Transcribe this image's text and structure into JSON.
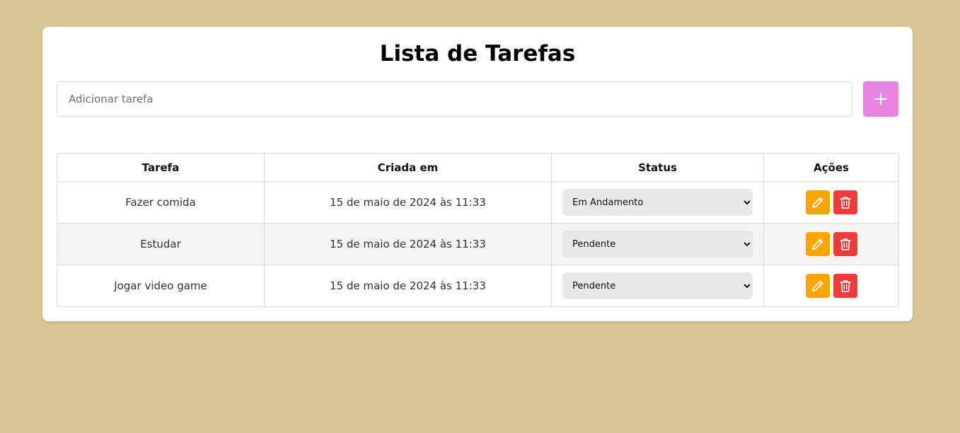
{
  "page": {
    "title": "Lista de Tarefas"
  },
  "add_task": {
    "placeholder": "Adicionar tarefa",
    "value": "",
    "button_label": "+"
  },
  "table": {
    "headers": {
      "task": "Tarefa",
      "created": "Criada em",
      "status": "Status",
      "actions": "Ações"
    },
    "rows": [
      {
        "task": "Fazer comida",
        "created": "15 de maio de 2024 às 11:33",
        "status": "Em Andamento"
      },
      {
        "task": "Estudar",
        "created": "15 de maio de 2024 às 11:33",
        "status": "Pendente"
      },
      {
        "task": "Jogar video game",
        "created": "15 de maio de 2024 às 11:33",
        "status": "Pendente"
      }
    ]
  },
  "icons": {
    "edit": "pencil-icon",
    "delete": "trash-icon"
  },
  "colors": {
    "background": "#dbc795",
    "add_button": "#e884e2",
    "edit_button": "#ffa500",
    "delete_button": "#ee3b3b"
  }
}
